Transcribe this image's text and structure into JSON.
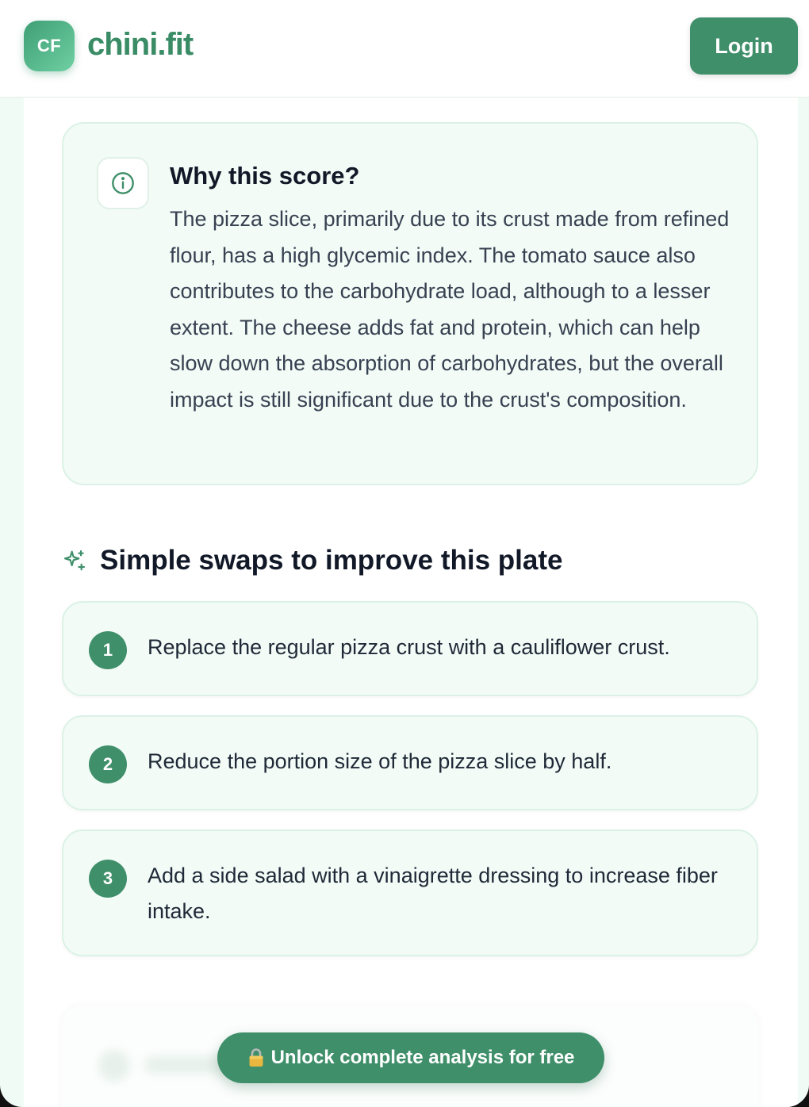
{
  "header": {
    "logo_initials": "CF",
    "brand_name": "chini.fit",
    "login_label": "Login"
  },
  "why_score": {
    "title": "Why this score?",
    "text": "The pizza slice, primarily due to its crust made from refined flour, has a high glycemic index. The tomato sauce also contributes to the carbohydrate load, although to a lesser extent. The cheese adds fat and protein, which can help slow down the absorption of carbohydrates, but the overall impact is still significant due to the crust's composition."
  },
  "swaps": {
    "title": "Simple swaps to improve this plate",
    "items": [
      {
        "number": "1",
        "text": "Replace the regular pizza crust with a cauliflower crust."
      },
      {
        "number": "2",
        "text": "Reduce the portion size of the pizza slice by half."
      },
      {
        "number": "3",
        "text": "Add a side salad with a vinaigrette dressing to increase fiber intake."
      }
    ]
  },
  "unlock": {
    "label": "Unlock complete analysis for free"
  },
  "colors": {
    "brand_green": "#3f8f6a",
    "card_bg": "#f2fbf6",
    "card_border": "#dcf2e6"
  },
  "icons": {
    "info": "info-circle-icon",
    "sparkle": "sparkles-icon",
    "lock": "lock-icon"
  }
}
